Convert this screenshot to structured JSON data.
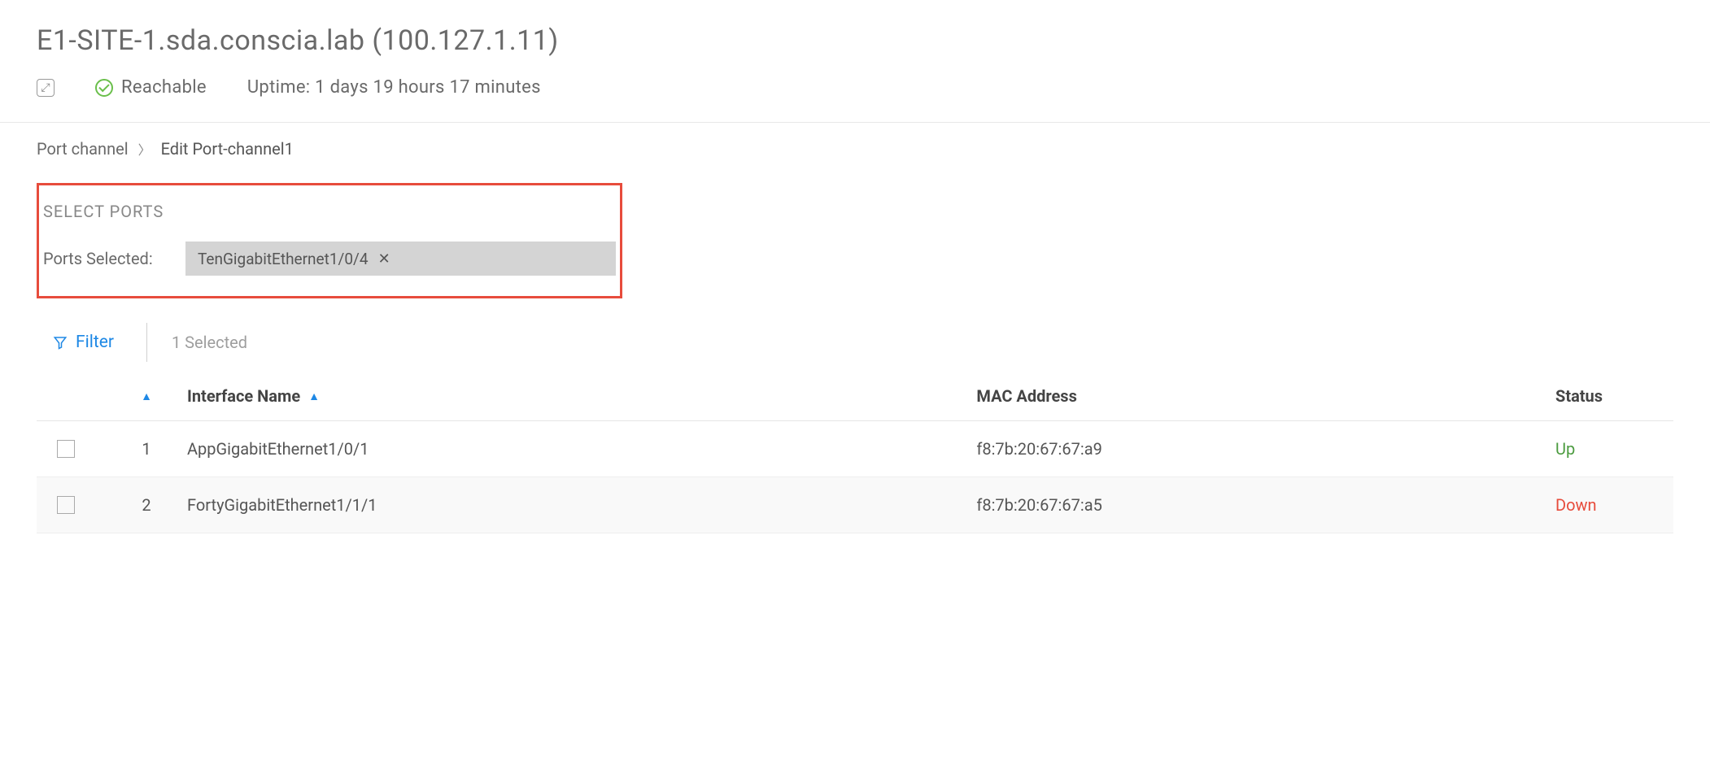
{
  "header": {
    "title": "E1-SITE-1.sda.conscia.lab (100.127.1.11)",
    "reachable_label": "Reachable",
    "uptime_label": "Uptime: 1 days 19 hours 17 minutes"
  },
  "breadcrumb": {
    "parent": "Port channel",
    "current": "Edit Port-channel1"
  },
  "select_ports": {
    "section_label": "SELECT PORTS",
    "selected_label": "Ports Selected:",
    "chip_value": "TenGigabitEthernet1/0/4"
  },
  "toolbar": {
    "filter_label": "Filter",
    "selected_text": "1 Selected"
  },
  "table": {
    "headers": {
      "interface": "Interface Name",
      "mac": "MAC Address",
      "status": "Status"
    },
    "rows": [
      {
        "num": "1",
        "interface": "AppGigabitEthernet1/0/1",
        "mac": "f8:7b:20:67:67:a9",
        "status": "Up",
        "status_class": "status-up"
      },
      {
        "num": "2",
        "interface": "FortyGigabitEthernet1/1/1",
        "mac": "f8:7b:20:67:67:a5",
        "status": "Down",
        "status_class": "status-down"
      }
    ]
  }
}
